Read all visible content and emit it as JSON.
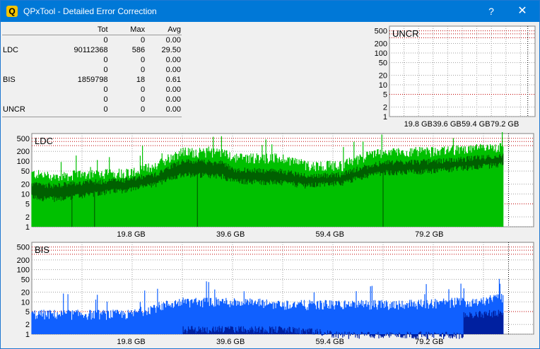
{
  "window": {
    "title": "QPxTool - Detailed Error Correction",
    "app_icon_glyph": "Q",
    "help_glyph": "?",
    "close_glyph": "✕"
  },
  "stats": {
    "headers": [
      "",
      "Tot",
      "Max",
      "Avg"
    ],
    "rows": [
      {
        "label": "",
        "tot": "0",
        "max": "0",
        "avg": "0.00"
      },
      {
        "label": "LDC",
        "tot": "90112368",
        "max": "586",
        "avg": "29.50"
      },
      {
        "label": "",
        "tot": "0",
        "max": "0",
        "avg": "0.00"
      },
      {
        "label": "",
        "tot": "0",
        "max": "0",
        "avg": "0.00"
      },
      {
        "label": "BIS",
        "tot": "1859798",
        "max": "18",
        "avg": "0.61"
      },
      {
        "label": "",
        "tot": "0",
        "max": "0",
        "avg": "0.00"
      },
      {
        "label": "",
        "tot": "0",
        "max": "0",
        "avg": "0.00"
      },
      {
        "label": "UNCR",
        "tot": "0",
        "max": "0",
        "avg": "0.00"
      }
    ]
  },
  "colors": {
    "ldc_light": "#00c000",
    "ldc_dark": "#006000",
    "bis_light": "#1060ff",
    "bis_dark": "#0020a0",
    "red_grid": "#c00000",
    "grid": "#a0a0a0",
    "plot_bg": "#ffffff"
  },
  "chart_data": [
    {
      "type": "area",
      "title": "UNCR",
      "y_scale": "log",
      "y_ticks": [
        "500",
        "200",
        "100",
        "50",
        "20",
        "10",
        "5",
        "2",
        "1"
      ],
      "x_ticks": [
        "19.8 GB",
        "39.6 GB",
        "59.4 GB",
        "79.2 GB"
      ],
      "series": []
    },
    {
      "type": "area",
      "title": "LDC",
      "y_scale": "log",
      "y_ticks": [
        "500",
        "200",
        "100",
        "50",
        "20",
        "10",
        "5",
        "2",
        "1"
      ],
      "x_ticks": [
        "19.8 GB",
        "39.6 GB",
        "59.4 GB",
        "79.2 GB"
      ],
      "x_end_gb": 94,
      "series": [
        {
          "peak": [
            [
              0,
              50
            ],
            [
              5,
              40
            ],
            [
              10,
              50
            ],
            [
              20,
              55
            ],
            [
              25,
              90
            ],
            [
              30,
              230
            ],
            [
              38,
              220
            ],
            [
              40,
              160
            ],
            [
              50,
              150
            ],
            [
              55,
              90
            ],
            [
              62,
              90
            ],
            [
              70,
              230
            ],
            [
              80,
              240
            ],
            [
              90,
              300
            ],
            [
              94,
              330
            ]
          ],
          "mid": [
            [
              0,
              20
            ],
            [
              5,
              18
            ],
            [
              10,
              22
            ],
            [
              20,
              28
            ],
            [
              25,
              40
            ],
            [
              30,
              100
            ],
            [
              38,
              90
            ],
            [
              40,
              55
            ],
            [
              50,
              50
            ],
            [
              55,
              35
            ],
            [
              62,
              40
            ],
            [
              70,
              90
            ],
            [
              80,
              100
            ],
            [
              90,
              130
            ],
            [
              94,
              150
            ]
          ],
          "low": [
            [
              0,
              8
            ],
            [
              5,
              7
            ],
            [
              10,
              9
            ],
            [
              20,
              14
            ],
            [
              25,
              20
            ],
            [
              30,
              40
            ],
            [
              38,
              35
            ],
            [
              40,
              25
            ],
            [
              50,
              22
            ],
            [
              55,
              18
            ],
            [
              62,
              22
            ],
            [
              70,
              45
            ],
            [
              80,
              50
            ],
            [
              90,
              70
            ],
            [
              94,
              80
            ]
          ]
        }
      ]
    },
    {
      "type": "area",
      "title": "BIS",
      "y_scale": "log",
      "y_ticks": [
        "500",
        "200",
        "100",
        "50",
        "20",
        "10",
        "5",
        "2",
        "1"
      ],
      "x_ticks": [
        "19.8 GB",
        "39.6 GB",
        "59.4 GB",
        "79.2 GB"
      ],
      "x_end_gb": 94,
      "series": [
        {
          "peak": [
            [
              0,
              5
            ],
            [
              10,
              5
            ],
            [
              20,
              5
            ],
            [
              30,
              12
            ],
            [
              40,
              12
            ],
            [
              50,
              10
            ],
            [
              62,
              10
            ],
            [
              70,
              10
            ],
            [
              80,
              11
            ],
            [
              90,
              13
            ],
            [
              94,
              17
            ]
          ],
          "mid": [
            [
              0,
              4
            ],
            [
              10,
              4
            ],
            [
              20,
              4
            ],
            [
              30,
              8
            ],
            [
              40,
              8
            ],
            [
              50,
              7
            ],
            [
              62,
              7
            ],
            [
              70,
              7
            ],
            [
              80,
              8
            ],
            [
              90,
              10
            ],
            [
              94,
              12
            ]
          ],
          "dark": [
            [
              0,
              0
            ],
            [
              30,
              0
            ],
            [
              30,
              1.5
            ],
            [
              50,
              1.5
            ],
            [
              62,
              1
            ],
            [
              80,
              1
            ],
            [
              86,
              1
            ],
            [
              86,
              4
            ],
            [
              94,
              5
            ]
          ]
        }
      ]
    }
  ]
}
